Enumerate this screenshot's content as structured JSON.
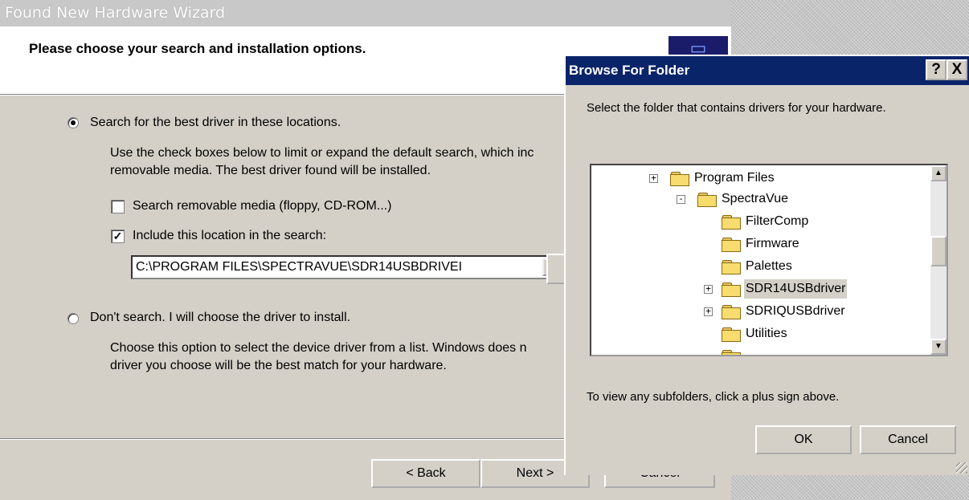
{
  "wizard": {
    "title": "Found New Hardware Wizard",
    "heading": "Please choose your search and installation options.",
    "option_search_label": "Search for the best driver in these locations.",
    "option_search_desc_line1": "Use the check boxes below to limit or expand the default search, which inc",
    "option_search_desc_line2": "removable media. The best driver found will be installed.",
    "check_removable_label": "Search removable media (floppy, CD-ROM...)",
    "check_removable_checked": false,
    "check_location_label": "Include this location in the search:",
    "check_location_checked": true,
    "location_value": "C:\\PROGRAM FILES\\SPECTRAVUE\\SDR14USBDRIVEI",
    "option_dont_search_label": "Don't search. I will choose the driver to install.",
    "option_dont_search_desc_line1": "Choose this option to select the device driver from a list.  Windows does n",
    "option_dont_search_desc_line2": "driver you choose will be the best match for your hardware.",
    "selected_option": "search",
    "back_label": "< Back",
    "next_label": "Next >",
    "cancel_label": "Cancel"
  },
  "browse_dialog": {
    "title": "Browse For Folder",
    "help_button": "?",
    "close_button": "X",
    "instruction": "Select the folder that contains drivers for your hardware.",
    "tree": [
      {
        "label": "Program Files",
        "expander": "+"
      },
      {
        "label": "SpectraVue",
        "expander": "-"
      },
      {
        "label": "FilterComp",
        "expander": ""
      },
      {
        "label": "Firmware",
        "expander": ""
      },
      {
        "label": "Palettes",
        "expander": ""
      },
      {
        "label": "SDR14USBdriver",
        "expander": "+",
        "selected": true
      },
      {
        "label": "SDRIQUSBdriver",
        "expander": "+"
      },
      {
        "label": "Utilities",
        "expander": ""
      }
    ],
    "hint": "To view any subfolders, click a plus sign above.",
    "ok_label": "OK",
    "cancel_label": "Cancel"
  },
  "colors": {
    "dialog_face": "#d4d0c8",
    "title_active": "#0a246a",
    "title_inactive": "#c8c8c8"
  }
}
